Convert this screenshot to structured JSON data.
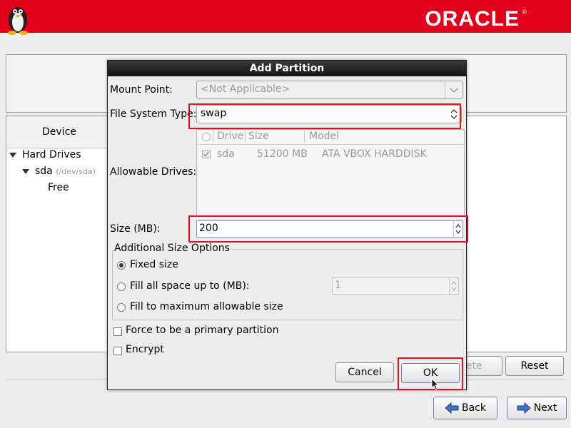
{
  "banner": {
    "brand": "ORACLE",
    "reg_mark": "®"
  },
  "tree": {
    "header": "Device",
    "hard_drives": "Hard Drives",
    "sda_label": "sda",
    "sda_path": "(/dev/sda)",
    "free": "Free"
  },
  "buttons": {
    "delete_partial": "lete",
    "reset": "Reset",
    "back": "Back",
    "next": "Next"
  },
  "dialog": {
    "title": "Add Partition",
    "mount_point_label": "Mount Point:",
    "mount_point_value": "<Not Applicable>",
    "fs_type_label": "File System Type:",
    "fs_type_value": "swap",
    "allowable_drives_label": "Allowable Drives:",
    "drives_headers": [
      "Drive",
      "Size",
      "Model"
    ],
    "drives_rows": [
      {
        "drive": "sda",
        "size": "51200 MB",
        "model": "ATA VBOX HARDDISK",
        "checked": true
      }
    ],
    "size_label": "Size (MB):",
    "size_value": "200",
    "size_options_title": "Additional Size Options",
    "opt_fixed": "Fixed size",
    "opt_fill_upto": "Fill all space up to (MB):",
    "fill_upto_value": "1",
    "opt_fill_max": "Fill to maximum allowable size",
    "force_primary": "Force to be a primary partition",
    "encrypt": "Encrypt",
    "cancel": "Cancel",
    "ok": "OK"
  },
  "colors": {
    "banner": "#e2001a",
    "highlight": "#dd1122"
  }
}
